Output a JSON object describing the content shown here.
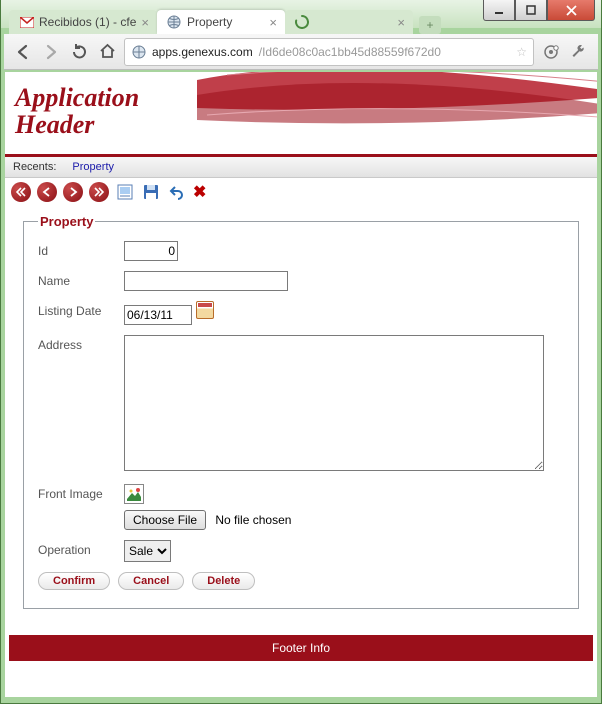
{
  "window": {
    "tabs": [
      {
        "title": "Recibidos (1) - cfe",
        "active": false,
        "icon": "gmail"
      },
      {
        "title": "Property",
        "active": true,
        "icon": "globe"
      },
      {
        "title": "",
        "active": false,
        "icon": "spinner"
      }
    ]
  },
  "browser": {
    "host": "apps.genexus.com",
    "path": "/Id6de08c0ac1bb45d88559f672d0"
  },
  "app": {
    "header_title": "Application\nHeader",
    "recents_label": "Recents:",
    "recents_link": "Property"
  },
  "toolbar_icons": [
    "first",
    "prev",
    "next",
    "last",
    "select",
    "save",
    "undo",
    "delete"
  ],
  "form": {
    "legend": "Property",
    "labels": {
      "id": "Id",
      "name": "Name",
      "listing_date": "Listing Date",
      "address": "Address",
      "front_image": "Front Image",
      "operation": "Operation"
    },
    "values": {
      "id": "0",
      "name": "",
      "listing_date": "06/13/11",
      "address": "",
      "operation_selected": "Sale"
    },
    "file": {
      "button": "Choose File",
      "status": "No file chosen"
    },
    "operation_options": [
      "Sale"
    ],
    "buttons": {
      "confirm": "Confirm",
      "cancel": "Cancel",
      "delete": "Delete"
    }
  },
  "footer": "Footer Info"
}
